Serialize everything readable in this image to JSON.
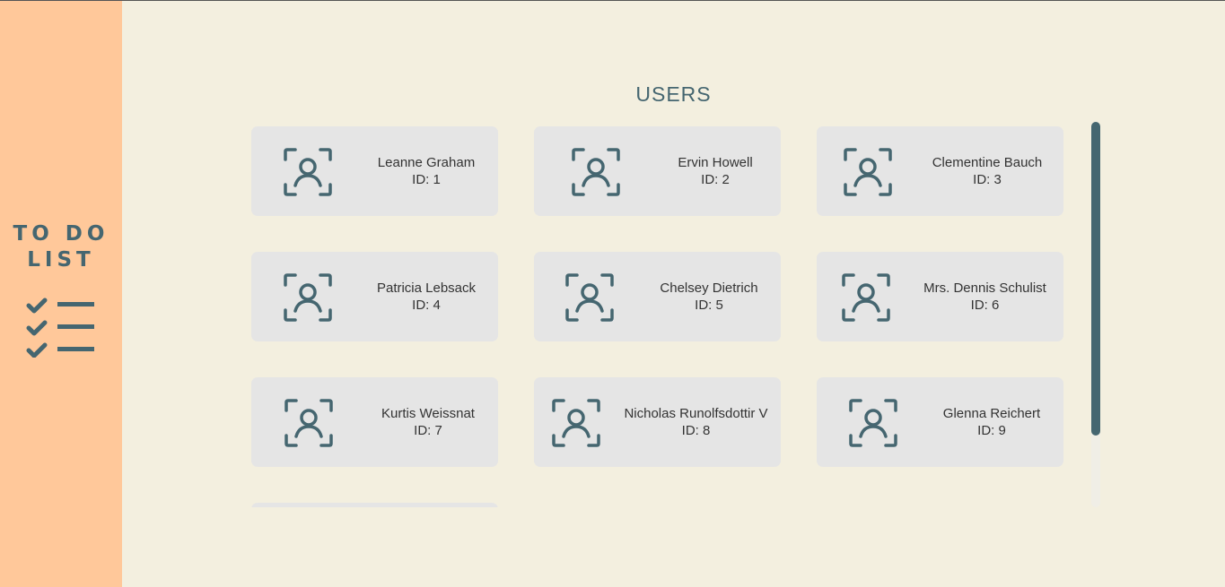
{
  "sidebar": {
    "logo_line1": "TO DO",
    "logo_line2": "LIST",
    "logo_icon": "checklist-icon"
  },
  "title": "USERS",
  "colors": {
    "sidebar_bg": "#ffc89a",
    "page_bg": "#f3efdf",
    "card_bg": "#e5e5e5",
    "accent": "#456670"
  },
  "users": [
    {
      "name": "Leanne Graham",
      "id": "ID: 1",
      "icon": "user-icon"
    },
    {
      "name": "Ervin Howell",
      "id": "ID: 2",
      "icon": "user-icon"
    },
    {
      "name": "Clementine Bauch",
      "id": "ID: 3",
      "icon": "user-icon"
    },
    {
      "name": "Patricia Lebsack",
      "id": "ID: 4",
      "icon": "user-icon"
    },
    {
      "name": "Chelsey Dietrich",
      "id": "ID: 5",
      "icon": "user-icon"
    },
    {
      "name": "Mrs. Dennis Schulist",
      "id": "ID: 6",
      "icon": "user-icon"
    },
    {
      "name": "Kurtis Weissnat",
      "id": "ID: 7",
      "icon": "user-icon"
    },
    {
      "name": "Nicholas Runolfsdottir V",
      "id": "ID: 8",
      "icon": "user-icon"
    },
    {
      "name": "Glenna Reichert",
      "id": "ID: 9",
      "icon": "user-icon"
    }
  ]
}
